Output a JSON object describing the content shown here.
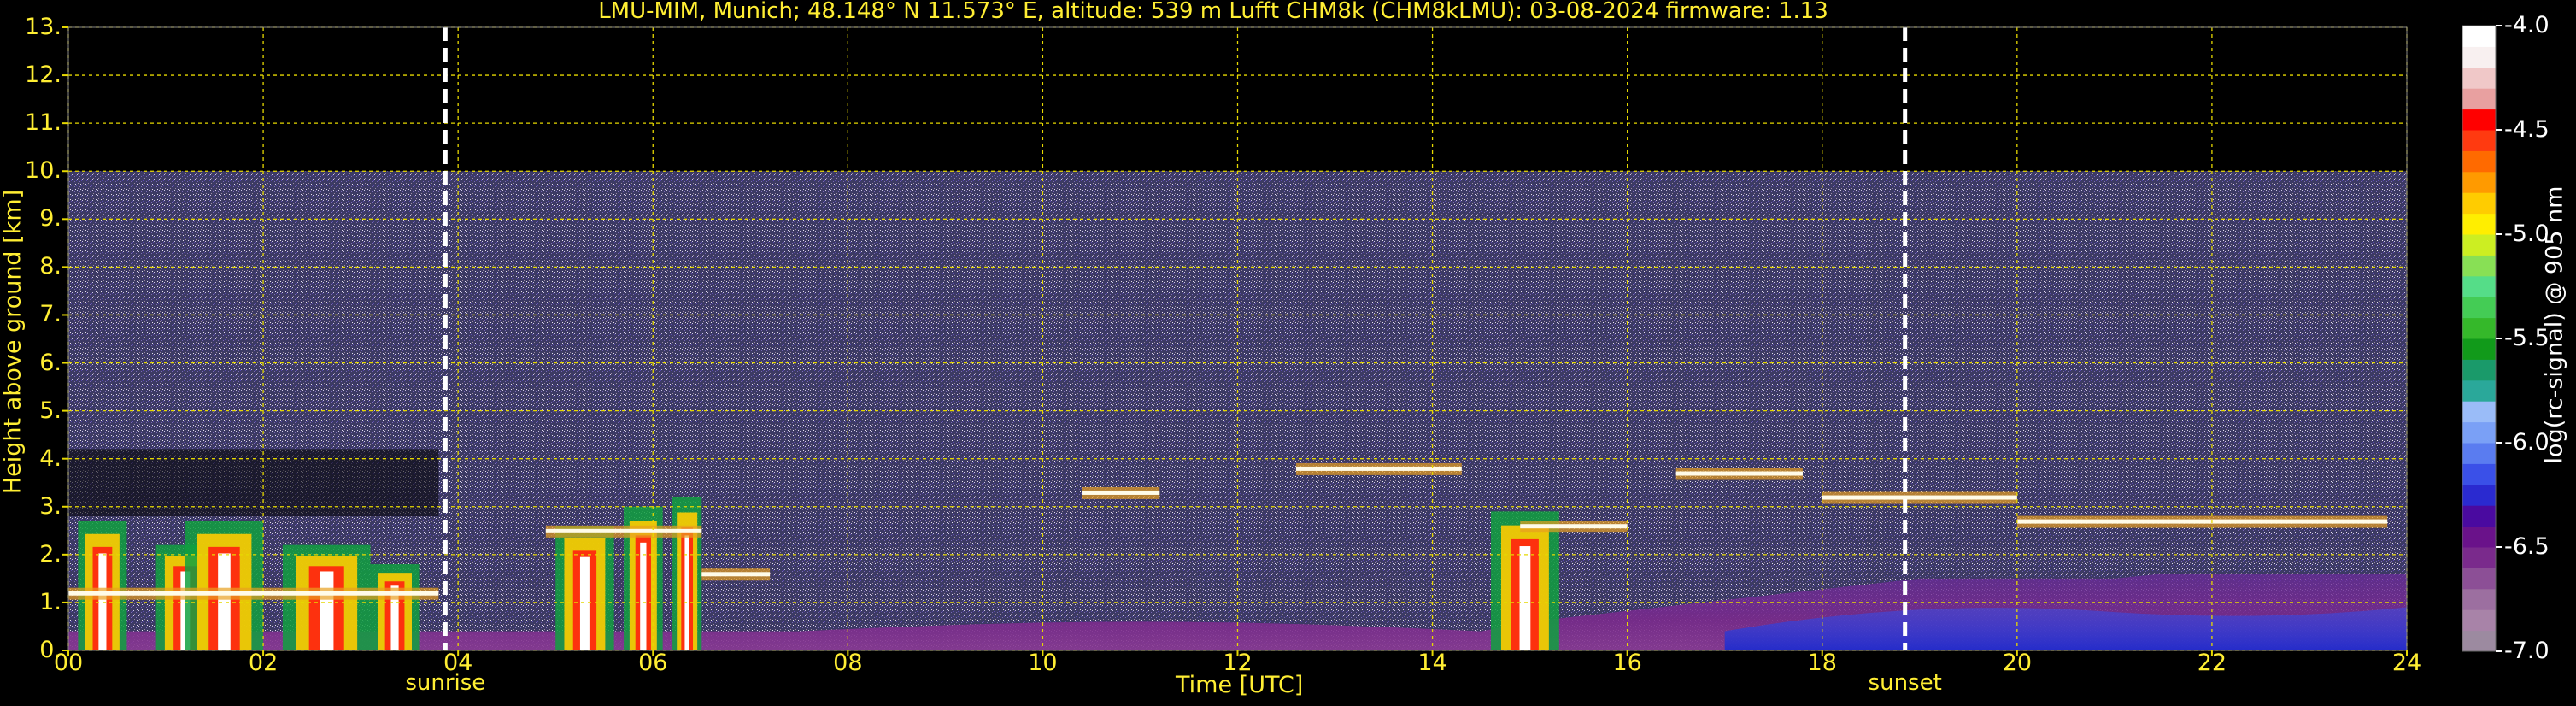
{
  "chart_data": {
    "type": "heatmap",
    "title": "LMU-MIM, Munich; 48.148° N 11.573° E, altitude: 539 m    Lufft CHM8k (CHM8kLMU): 03-08-2024    firmware: 1.13",
    "xlabel": "Time [UTC]",
    "ylabel": "Height above ground [km]",
    "xlim": [
      0,
      24
    ],
    "ylim": [
      0,
      13
    ],
    "x_ticks": [
      "00",
      "02",
      "04",
      "06",
      "08",
      "10",
      "12",
      "14",
      "16",
      "18",
      "20",
      "22",
      "24"
    ],
    "y_ticks": [
      "0.",
      "1.",
      "2.",
      "3.",
      "4.",
      "5.",
      "6.",
      "7.",
      "8.",
      "9.",
      "10.",
      "11.",
      "12.",
      "13."
    ],
    "grid": true,
    "colorbar": {
      "label": "log(rc-signal) @ 905 nm",
      "range": [
        -7.0,
        -4.0
      ],
      "tick_labels": [
        "-4.0",
        "-4.5",
        "-5.0",
        "-5.5",
        "-6.0",
        "-6.5",
        "-7.0"
      ],
      "colors": [
        "#9c8aa0",
        "#a883a8",
        "#9c6fa0",
        "#8c4f96",
        "#7a2a8c",
        "#6a128a",
        "#4a0aa0",
        "#2a2ad0",
        "#3a50e8",
        "#5a7cf0",
        "#7aa0f6",
        "#9abcf8",
        "#2aa89a",
        "#1a9a6a",
        "#119a1a",
        "#35b82a",
        "#44cc55",
        "#55dd88",
        "#88e055",
        "#ccee22",
        "#ffee00",
        "#ffcc00",
        "#ff9a00",
        "#ff6a00",
        "#ff3a10",
        "#ff0000",
        "#e8a0a0",
        "#f0c8c8",
        "#f8f0f0",
        "#ffffff"
      ]
    },
    "markers": [
      {
        "label": "sunrise",
        "x": 3.87
      },
      {
        "label": "sunset",
        "x": 18.85
      }
    ],
    "observation_ceiling_km": 10.0,
    "cloud_layers": [
      {
        "x_start": 0.0,
        "x_end": 3.8,
        "height_km": 1.2
      },
      {
        "x_start": 4.9,
        "x_end": 6.5,
        "height_km": 2.5
      },
      {
        "x_start": 6.5,
        "x_end": 7.2,
        "height_km": 1.6
      },
      {
        "x_start": 10.4,
        "x_end": 11.2,
        "height_km": 3.3
      },
      {
        "x_start": 12.6,
        "x_end": 14.3,
        "height_km": 3.8
      },
      {
        "x_start": 14.9,
        "x_end": 16.0,
        "height_km": 2.6
      },
      {
        "x_start": 16.5,
        "x_end": 17.8,
        "height_km": 3.7
      },
      {
        "x_start": 18.0,
        "x_end": 20.0,
        "height_km": 3.2
      },
      {
        "x_start": 20.0,
        "x_end": 23.8,
        "height_km": 2.7
      }
    ]
  }
}
